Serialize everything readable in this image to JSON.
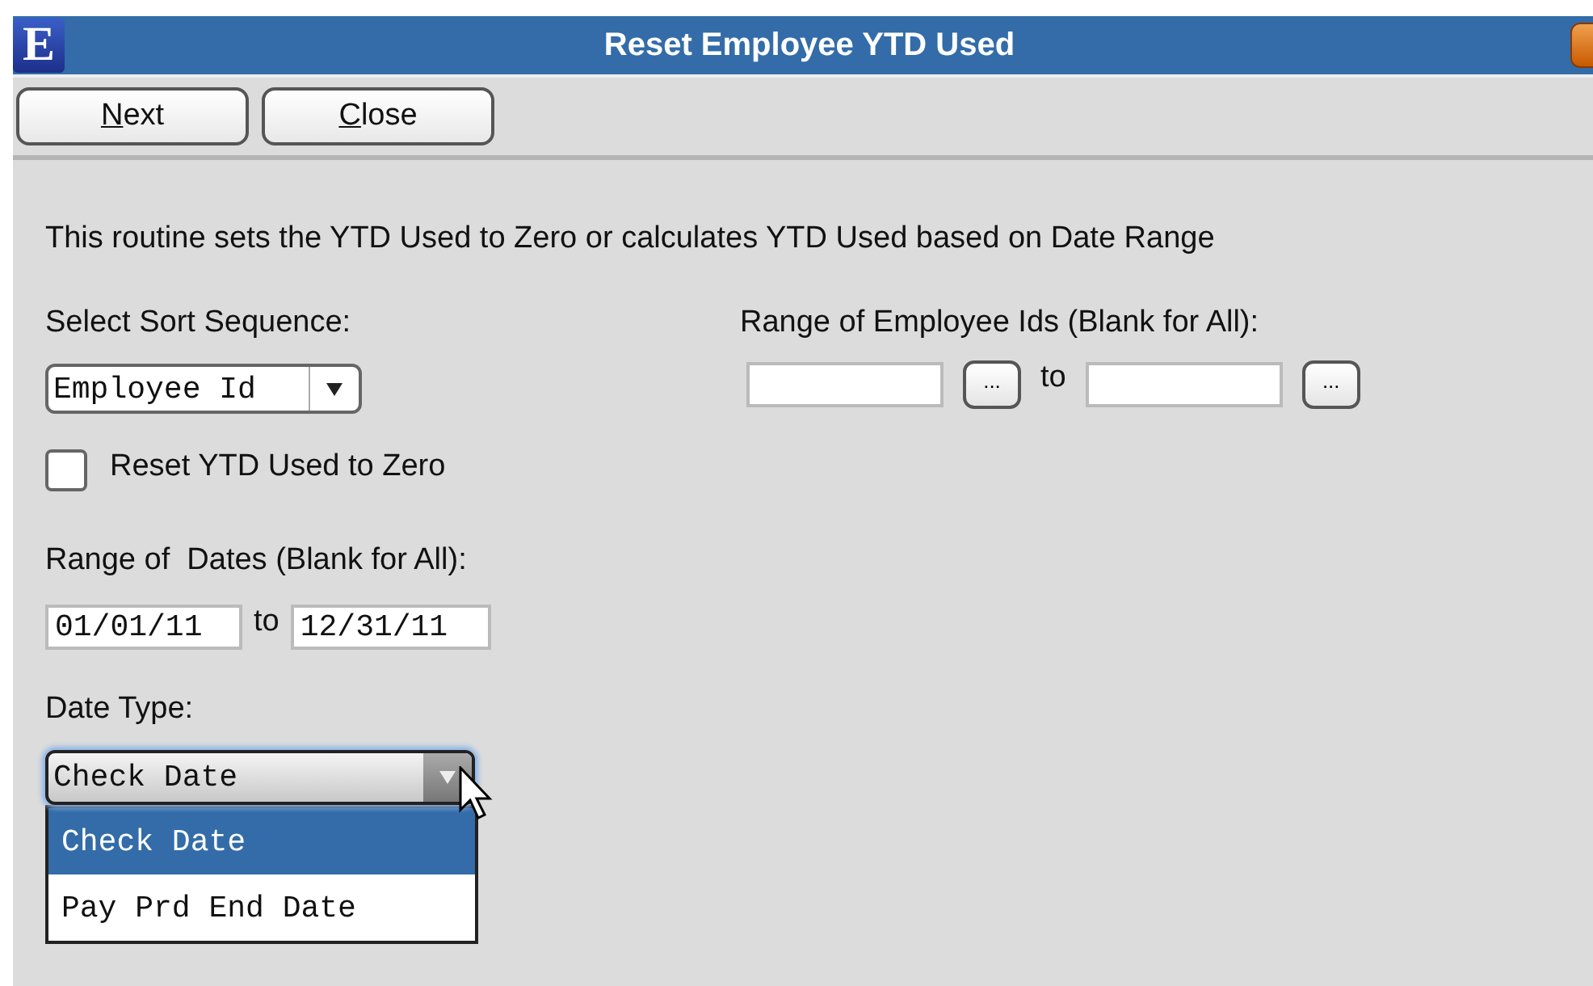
{
  "window": {
    "title": "Reset Employee YTD Used",
    "logo": "E"
  },
  "toolbar": {
    "buttons": [
      "Next",
      "Close"
    ]
  },
  "description": "This routine sets the YTD Used to Zero or calculates YTD Used based on Date Range",
  "sort": {
    "label": "Select Sort Sequence:",
    "value": "Employee Id"
  },
  "reset_checkbox": {
    "label": "Reset YTD Used to Zero",
    "checked": false
  },
  "employee_range": {
    "label": "Range of Employee Ids (Blank for All):",
    "to_label": "to",
    "lookup": "..."
  },
  "date_range": {
    "label": "Range of  Dates (Blank for All):",
    "from": "01/01/11",
    "to_label": "to",
    "to": "12/31/11"
  },
  "date_type": {
    "label": "Date Type:",
    "value": "Check Date",
    "expanded": true,
    "options": [
      {
        "label": "Check Date",
        "selected": true
      },
      {
        "label": "Pay Prd End Date",
        "selected": false
      }
    ]
  }
}
